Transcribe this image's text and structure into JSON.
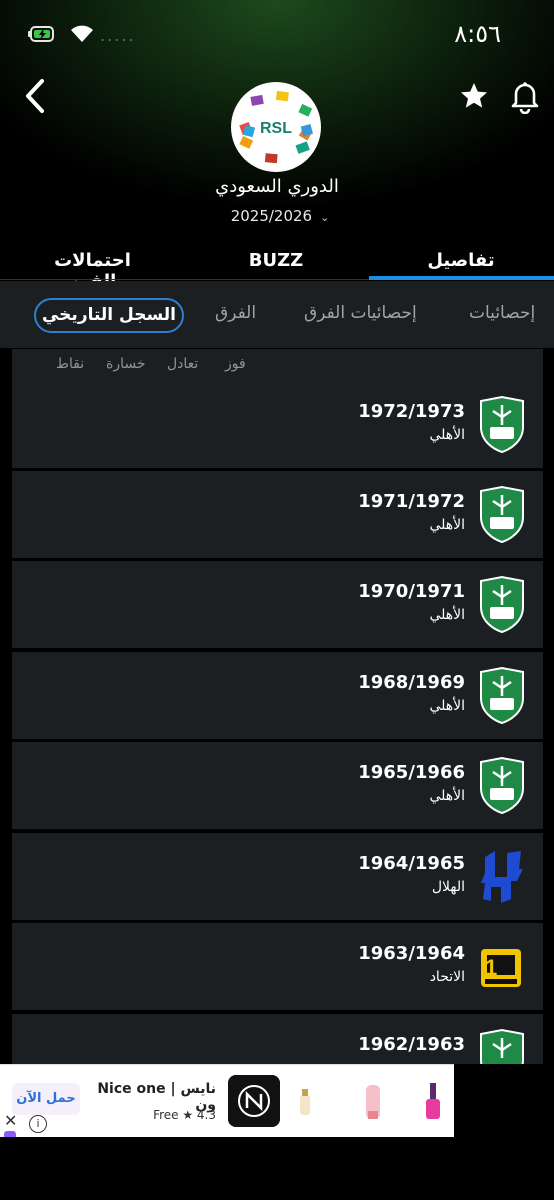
{
  "status_bar": {
    "time": "٨:٥٦",
    "battery_icon": "battery-charging-icon",
    "wifi_icon": "wifi-icon",
    "signal": "....."
  },
  "header": {
    "back_icon": "chevron-left-icon",
    "star_icon": "star-icon",
    "bell_icon": "bell-icon",
    "logo_text": "RSL",
    "league_name": "الدوري السعودي",
    "season": "2025/2026",
    "season_chevron": "⌄"
  },
  "tabs": [
    {
      "label": "احتمالات الفوز",
      "active": false
    },
    {
      "label": "BUZZ",
      "active": false
    },
    {
      "label": "تفاصيل",
      "active": true
    }
  ],
  "subtabs": [
    {
      "label": "السجل التاريخي",
      "active": true
    },
    {
      "label": "الفرق",
      "active": false
    },
    {
      "label": "إحصائيات الفرق",
      "active": false
    },
    {
      "label": "إحصائيات",
      "active": false
    }
  ],
  "table_headers": {
    "points": "نقاط",
    "loss": "خسارة",
    "draw": "تعادل",
    "win": "فوز"
  },
  "history": [
    {
      "season": "1972/1973",
      "club": "الأهلي",
      "crest": "al-ahli"
    },
    {
      "season": "1971/1972",
      "club": "الأهلي",
      "crest": "al-ahli"
    },
    {
      "season": "1970/1971",
      "club": "الأهلي",
      "crest": "al-ahli"
    },
    {
      "season": "1968/1969",
      "club": "الأهلي",
      "crest": "al-ahli"
    },
    {
      "season": "1965/1966",
      "club": "الأهلي",
      "crest": "al-ahli"
    },
    {
      "season": "1964/1965",
      "club": "الهلال",
      "crest": "al-hilal"
    },
    {
      "season": "1963/1964",
      "club": "الاتحاد",
      "crest": "al-ittihad"
    },
    {
      "season": "1962/1963",
      "club": "",
      "crest": "al-ahli"
    }
  ],
  "ad": {
    "cta": "حمل الآن",
    "title": "Nice one | نايس ون",
    "subtitle": "Free ★ 4.3",
    "close": "✕",
    "info": "i"
  },
  "colors": {
    "accent": "#1a8fe3",
    "row_bg": "#1b1f22",
    "ahli_green": "#1e8a46",
    "hilal_blue": "#1e4bd2",
    "ittihad_yellow": "#f2c300"
  }
}
